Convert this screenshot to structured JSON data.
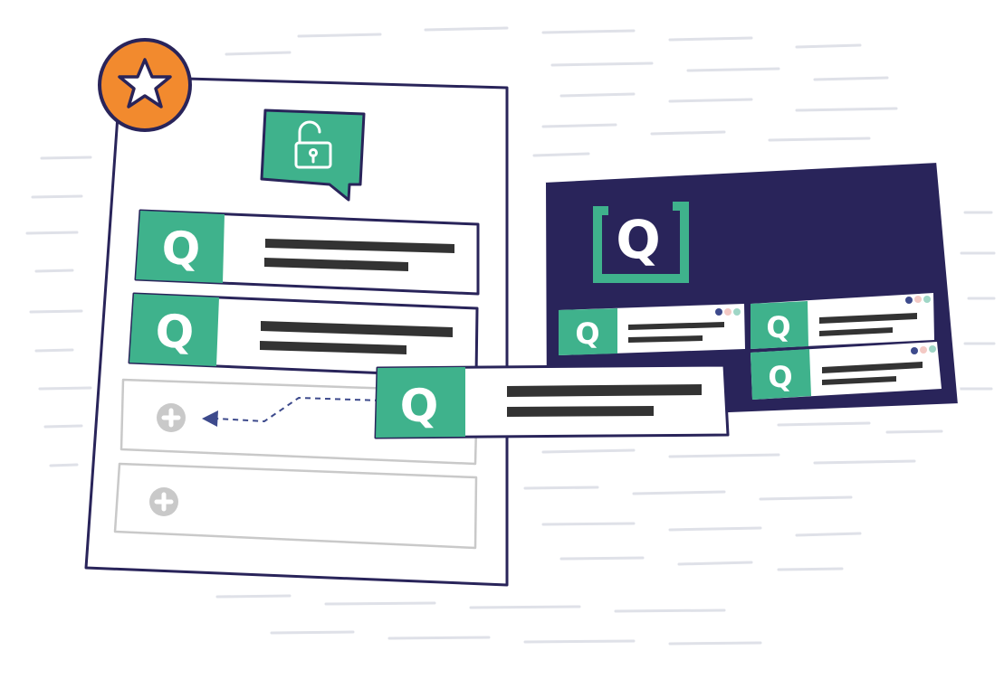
{
  "colors": {
    "navy": "#29245a",
    "green": "#3fb28c",
    "orange": "#f28a2e",
    "bar": "#333333",
    "grey": "#c9c9c9",
    "sketch": "#dfe1e8",
    "dot_navy": "#3d4a8c",
    "dot_pink": "#f3c9c4",
    "dot_teal": "#9fd6c6"
  },
  "icons": {
    "star": "star-icon",
    "lock": "unlocked-padlock-icon",
    "plus": "plus-circle-icon",
    "arrow": "dashed-arrow-icon",
    "logo": "bracket-q-logo",
    "q": "q-badge-icon"
  },
  "labels": {
    "q": "Q"
  }
}
